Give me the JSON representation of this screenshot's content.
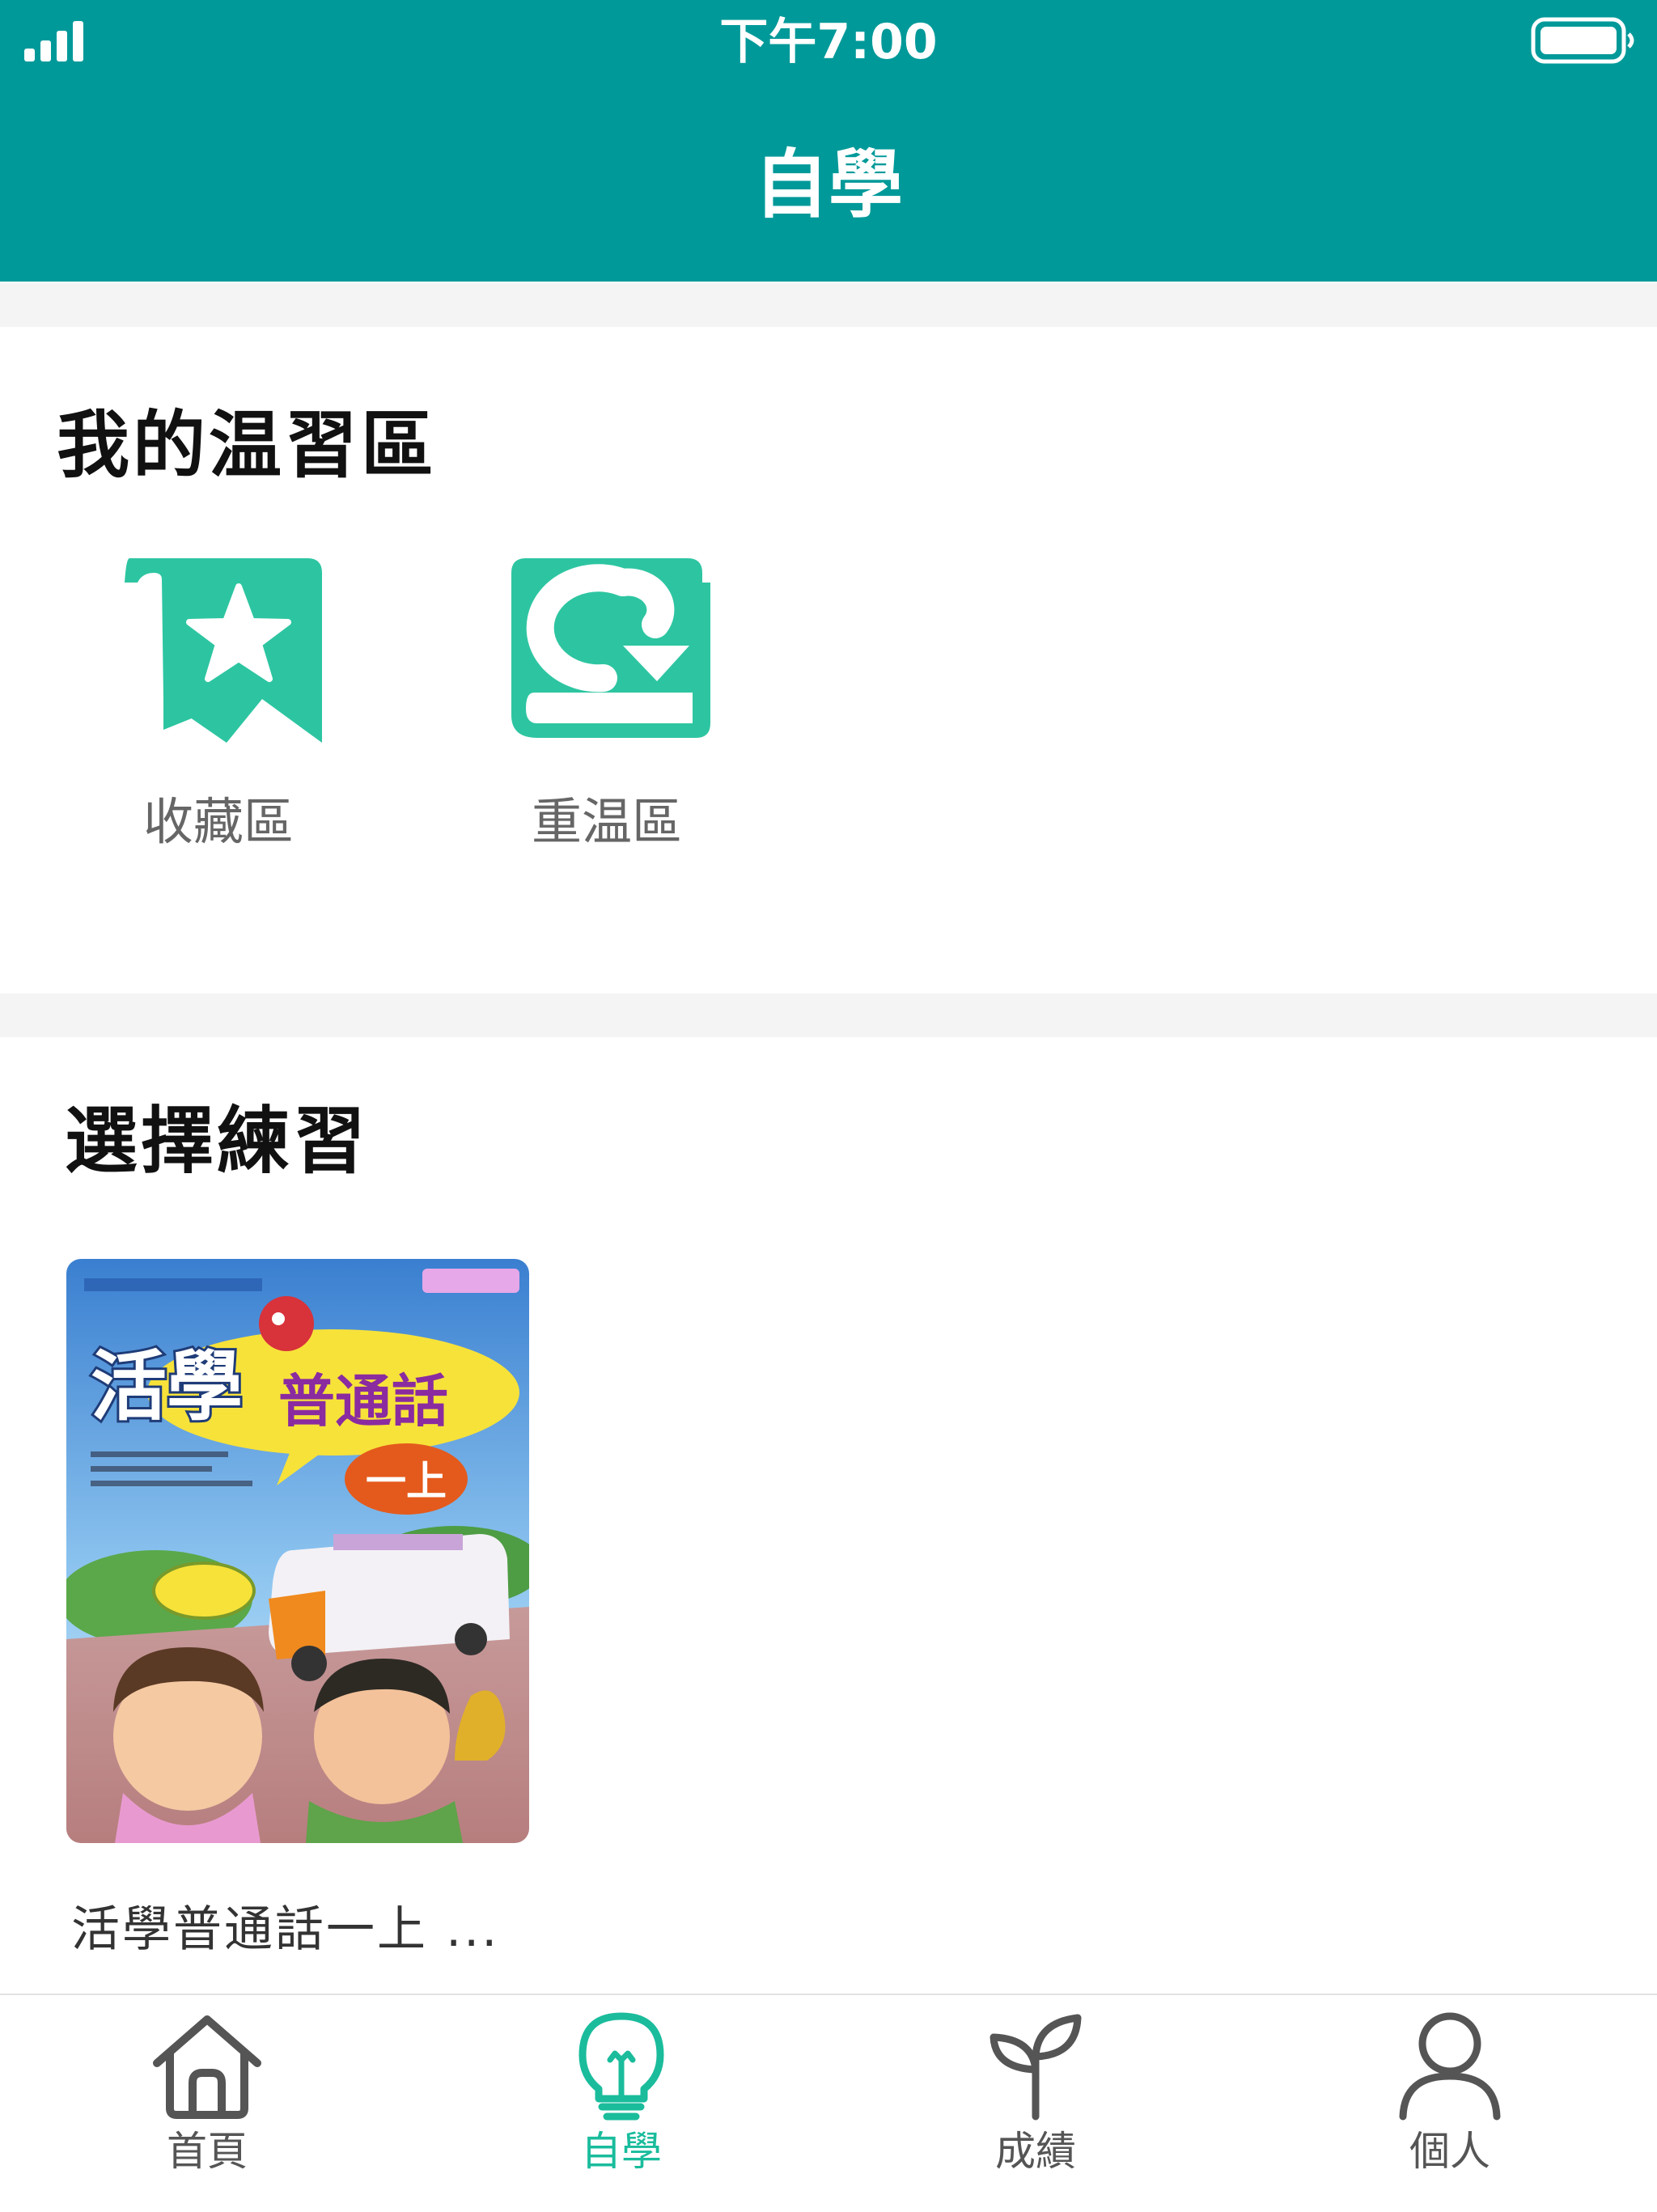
{
  "status_bar": {
    "time": "下午7:00"
  },
  "nav": {
    "title": "自學"
  },
  "review_area": {
    "title": "我的温習區",
    "items": [
      {
        "label": "收藏區",
        "icon": "bookmark-star-icon"
      },
      {
        "label": "重温區",
        "icon": "book-refresh-icon"
      }
    ]
  },
  "practice": {
    "title": "選擇練習",
    "books": [
      {
        "caption": "活學普通話一上 ...",
        "cover_title_left": "活學",
        "cover_title_right": "普通話",
        "cover_grade": "一上"
      }
    ]
  },
  "tabbar": {
    "tabs": [
      {
        "label": "首頁",
        "icon": "home-icon"
      },
      {
        "label": "自學",
        "icon": "lightbulb-icon",
        "active": true
      },
      {
        "label": "成績",
        "icon": "sprout-icon"
      },
      {
        "label": "個人",
        "icon": "person-icon"
      }
    ]
  },
  "colors": {
    "header": "#009999",
    "accent": "#2dc5a1",
    "active_tab": "#1abc9c",
    "inactive_tab": "#555555"
  }
}
